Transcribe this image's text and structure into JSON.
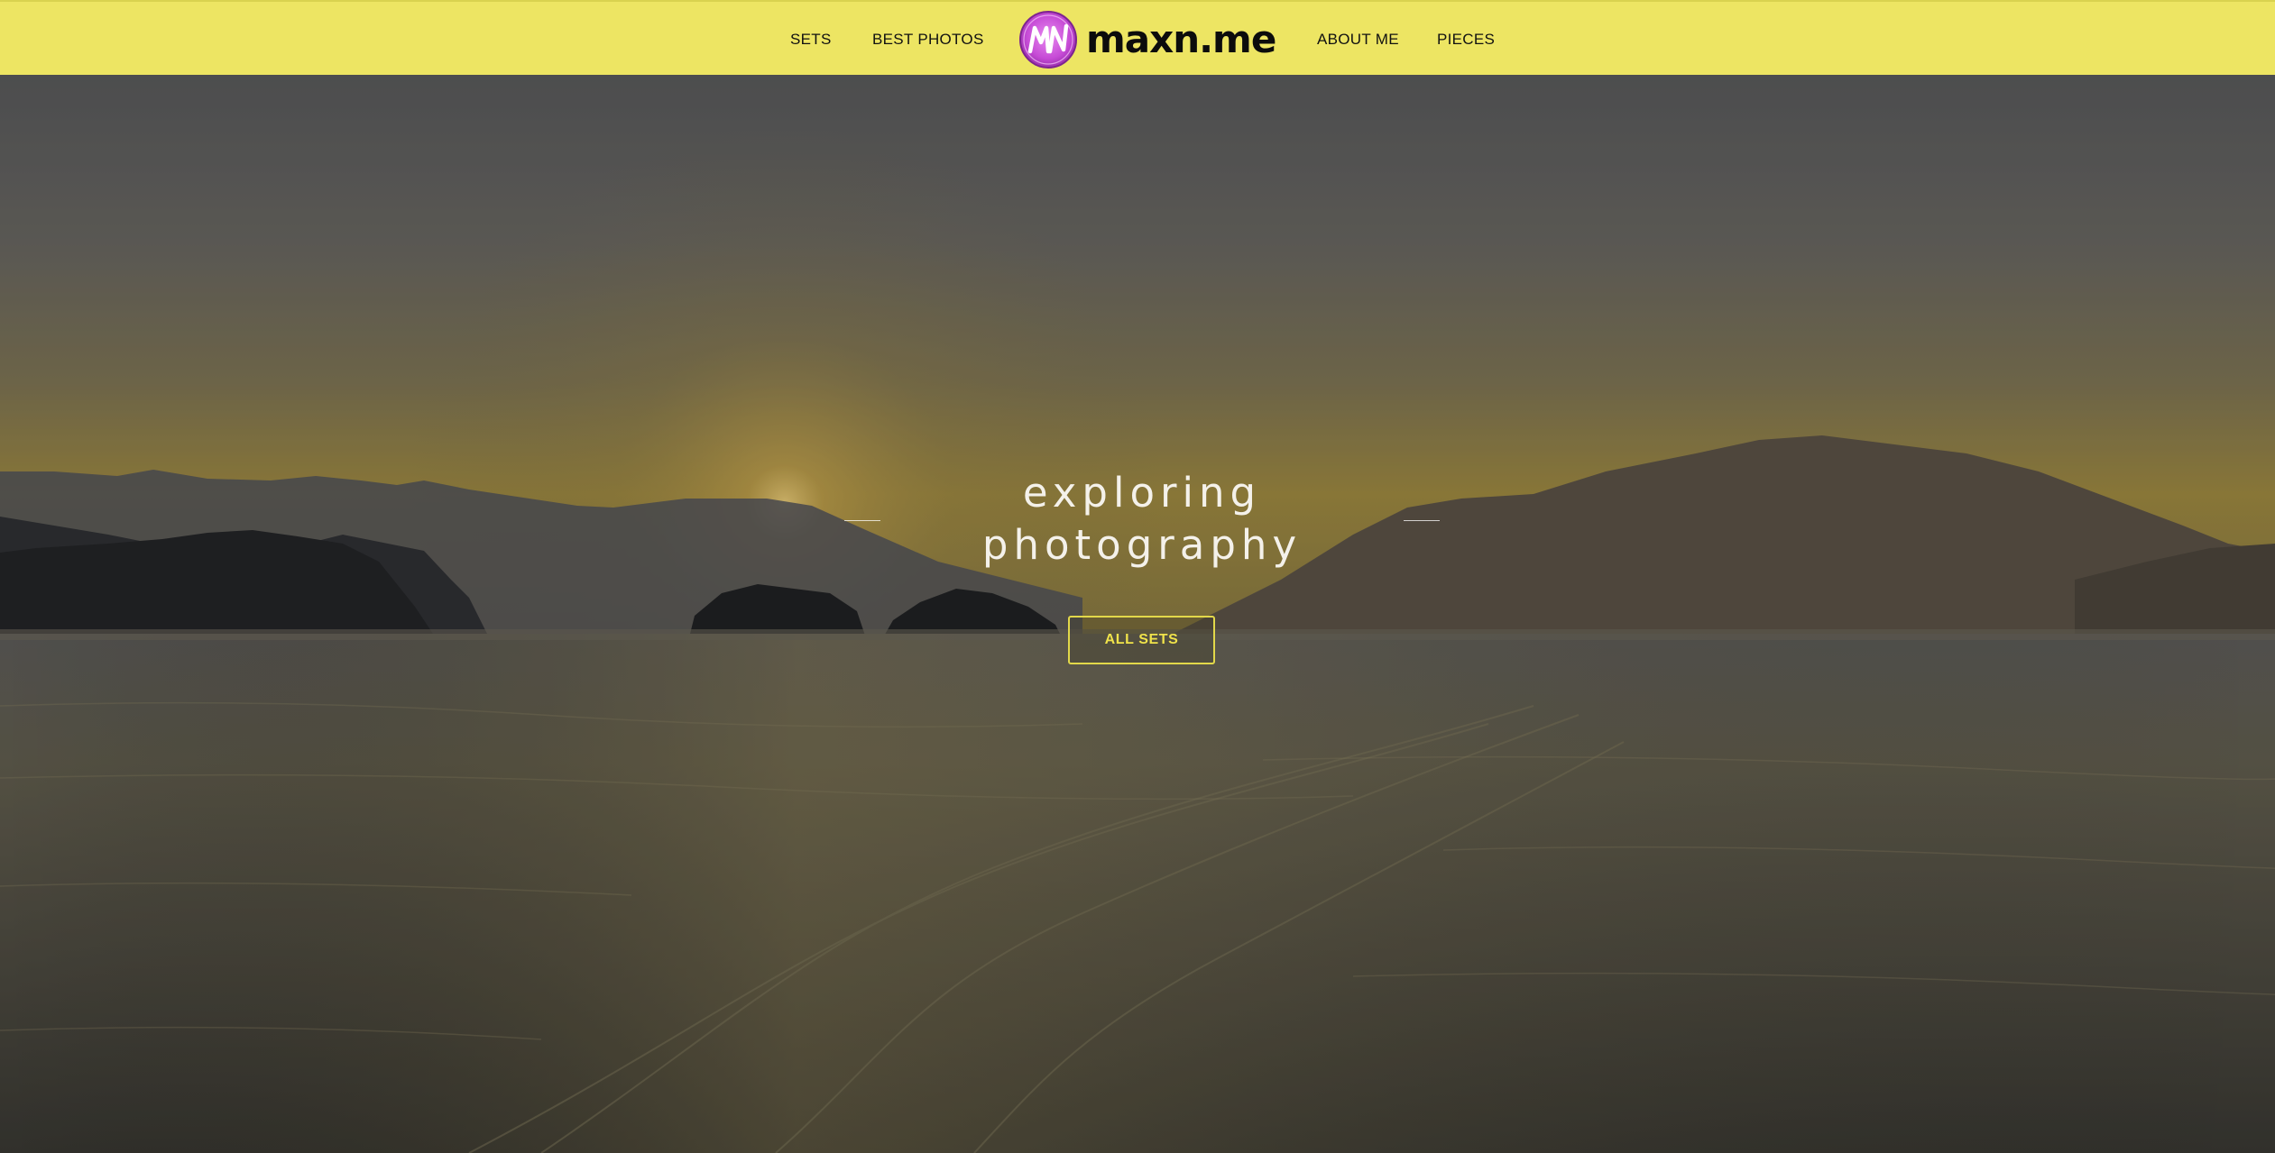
{
  "header": {
    "background_color": "#ede563",
    "nav_left": [
      {
        "label": "SETS"
      },
      {
        "label": "BEST PHOTOS"
      }
    ],
    "logo": {
      "text": "maxn.me",
      "mark_letters": "MN",
      "mark_color": "#c64bd6"
    },
    "nav_right": [
      {
        "label": "ABOUT ME"
      },
      {
        "label": "PIECES"
      }
    ]
  },
  "hero": {
    "title_line_1": "exploring",
    "title_line_2": "photography",
    "button_label": "ALL SETS",
    "button_color": "#e2d84a",
    "background_description_icon": "sunset-sea-photo"
  }
}
